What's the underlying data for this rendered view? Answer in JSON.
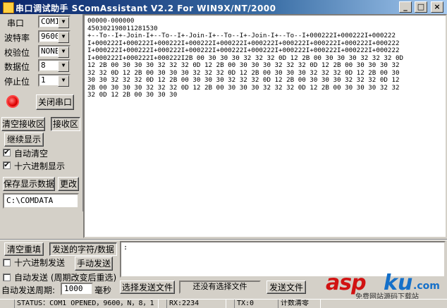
{
  "window": {
    "title": "串口调试助手  SComAssistant V2.2 For WIN9X/NT/2000",
    "min_label": "_",
    "max_label": "□",
    "close_label": "×"
  },
  "settings": {
    "port_label": "串口",
    "port_value": "COM1",
    "baud_label": "波特率",
    "baud_value": "9600",
    "parity_label": "校验位",
    "parity_value": "NONE",
    "databits_label": "数据位",
    "databits_value": "8",
    "stopbits_label": "停止位",
    "stopbits_value": "1"
  },
  "port_control": {
    "close_port_label": "关闭串口",
    "led_color": "#e00000"
  },
  "receive_controls": {
    "clear_recv_label": "清空接收区",
    "recv_area_label": "接收区",
    "continue_display_label": "继续显示",
    "auto_clear_label": "自动清空",
    "auto_clear_checked": "✔",
    "hex_display_label": "十六进制显示",
    "hex_display_checked": "✔",
    "save_data_label": "保存显示数据",
    "change_label": "更改",
    "save_path": "C:\\COMDATA"
  },
  "receive_text": "00000-000000\n450302198011281530\n+--To--I+-Join-I+--To--I+-Join-I+--To--I+-Join-I+--To--I+000222I+000222I+000222\nI+000222I+000222I+000222I+000222I+000222I+000222I+000222I+000222I+000222I+000222\nI+000222I+000222I+000222I+000222I+000222I+000222I+000222I+000222I+000222I+000222\nI+000222I+000222I+000222I2B 00 30 30 30 32 32 32 0D 12 2B 00 30 30 30 32 32 32 0D\n12 2B 00 30 30 30 32 32 32 0D 12 2B 00 30 30 30 32 32 32 0D 12 2B 00 30 30 30 32\n32 32 0D 12 2B 00 30 30 30 32 32 32 0D 12 2B 00 30 30 30 32 32 32 0D 12 2B 00 30\n30 30 32 32 32 0D 12 2B 00 30 30 30 32 32 32 0D 12 2B 00 30 30 30 32 32 32 0D 12\n2B 00 30 30 30 32 32 32 0D 12 2B 00 30 30 30 32 32 32 0D 12 2B 00 30 30 30 32 32\n32 0D 12 2B 00 30 30 30",
  "send_controls": {
    "clear_send_label": "清空重填",
    "send_chars_label": "发送的字符/数据",
    "hex_send_label": "十六进制发送",
    "manual_send_label": "手动发送",
    "auto_send_label": "自动发送 (周期改变后重选)",
    "auto_period_label": "自动发送周期:",
    "auto_period_value": "1000",
    "ms_label": "毫秒",
    "select_file_label": "选择发送文件",
    "no_file_label": "还没有选择文件",
    "send_file_label": "发送文件",
    "send_text": ":"
  },
  "status_bar": {
    "status": "STATUS：COM1 OPENED，9600，N，8，1",
    "rx": "RX:2234",
    "tx": "TX:0",
    "clear_count_label": "计数清零"
  },
  "watermark": {
    "asp": "asp",
    "ku": "ku",
    "com": ".com",
    "sub": "免费网站源码下载站"
  }
}
